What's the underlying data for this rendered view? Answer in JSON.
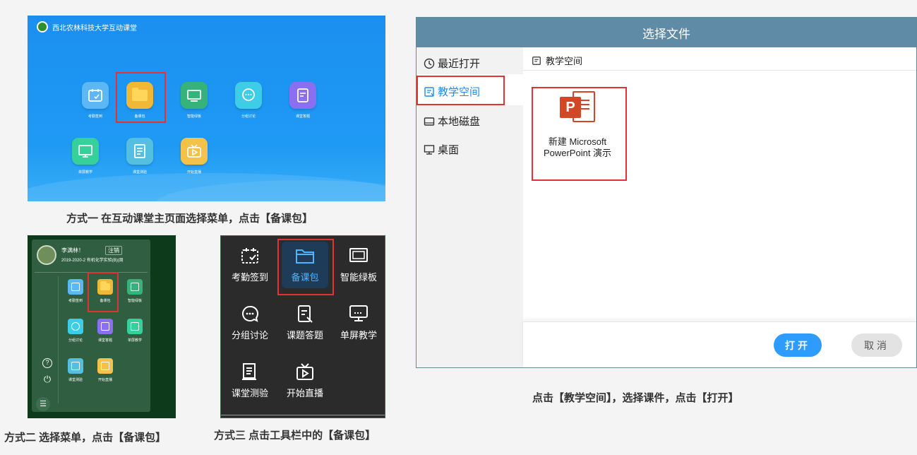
{
  "panel1": {
    "app_title": "西北农林科技大学互动课堂",
    "tiles": [
      {
        "label": "考勤签到",
        "icon": "attendance-icon",
        "color": "#5cb7f5"
      },
      {
        "label": "备课包",
        "icon": "folder-icon",
        "color": "#f0b836"
      },
      {
        "label": "智能绿板",
        "icon": "greenboard-icon",
        "color": "#35b37a"
      },
      {
        "label": "分组讨论",
        "icon": "chat-icon",
        "color": "#3ecde6"
      },
      {
        "label": "课堂答题",
        "icon": "quiz-icon",
        "color": "#8a6ff0"
      },
      {
        "label": "单屏教学",
        "icon": "screen-icon",
        "color": "#36d19b"
      },
      {
        "label": "课堂测验",
        "icon": "test-icon",
        "color": "#55bfe0"
      },
      {
        "label": "开始直播",
        "icon": "live-icon",
        "color": "#f4c24a"
      }
    ],
    "caption": "方式一 在互动课堂主页面选择菜单，点击【备课包】"
  },
  "panel2": {
    "user_name": "李满林！",
    "logout": "注销",
    "course": "2019-2020-2 有机化学实验(B)(周",
    "tiles": [
      {
        "label": "考勤签到",
        "icon": "attendance-icon"
      },
      {
        "label": "备课包",
        "icon": "folder-icon"
      },
      {
        "label": "智能绿板",
        "icon": "greenboard-icon"
      },
      {
        "label": "分组讨论",
        "icon": "chat-icon"
      },
      {
        "label": "课堂答题",
        "icon": "quiz-icon"
      },
      {
        "label": "单屏教学",
        "icon": "screen-icon"
      },
      {
        "label": "课堂测验",
        "icon": "test-icon"
      },
      {
        "label": "开始直播",
        "icon": "live-icon"
      }
    ],
    "help_glyph": "?",
    "power_glyph": "⏻",
    "menu_glyph": "☰",
    "caption": "方式二 选择菜单，点击【备课包】"
  },
  "panel3": {
    "tools": [
      {
        "label": "考勤签到",
        "icon": "attendance-icon"
      },
      {
        "label": "备课包",
        "icon": "folder-icon"
      },
      {
        "label": "智能绿板",
        "icon": "greenboard-icon"
      },
      {
        "label": "分组讨论",
        "icon": "chat-icon"
      },
      {
        "label": "课题答题",
        "icon": "quiz-icon"
      },
      {
        "label": "单屏教学",
        "icon": "screen-icon"
      },
      {
        "label": "课堂测验",
        "icon": "test-icon"
      },
      {
        "label": "开始直播",
        "icon": "live-icon"
      }
    ],
    "caption": "方式三 点击工具栏中的【备课包】"
  },
  "dialog": {
    "title": "选择文件",
    "sidebar": [
      {
        "label": "最近打开",
        "icon": "clock-icon"
      },
      {
        "label": "教学空间",
        "icon": "space-icon"
      },
      {
        "label": "本地磁盘",
        "icon": "disk-icon"
      },
      {
        "label": "桌面",
        "icon": "desktop-icon"
      }
    ],
    "breadcrumb": "教学空间",
    "file": {
      "name_line1": "新建 Microsoft",
      "name_line2": "PowerPoint 演示",
      "icon_letter": "P"
    },
    "open_button": "打开",
    "cancel_button": "取消",
    "caption": "点击【教学空间】，选择课件，点击【打开】"
  },
  "colors": {
    "accent": "#2e9bff",
    "highlight_box": "#e23232",
    "dialog_title": "#5f8ba6"
  }
}
